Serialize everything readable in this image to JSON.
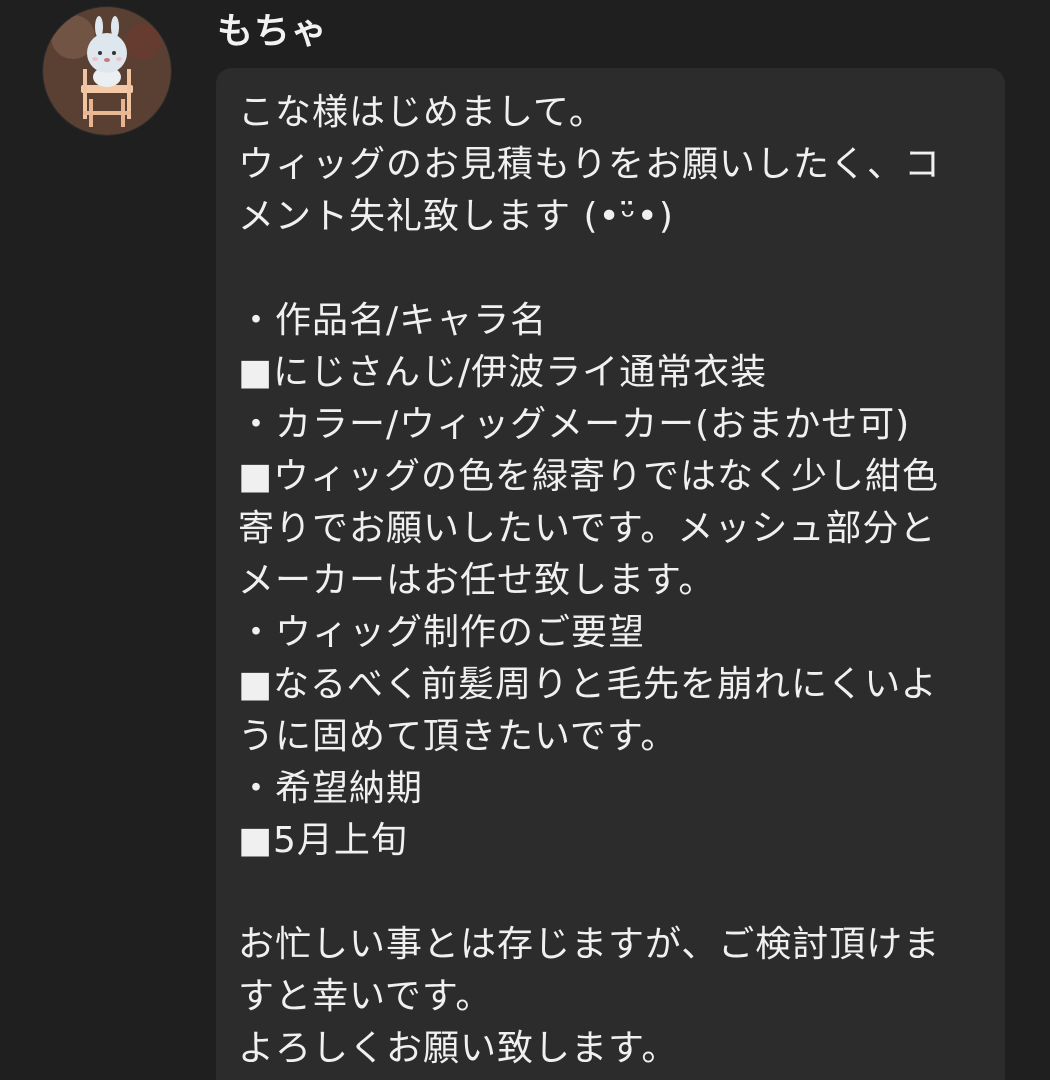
{
  "comment": {
    "author": {
      "name": "もちゃ",
      "avatar_icon": "character-figure-avatar"
    },
    "message_lines": [
      "こな様はじめまして。",
      "ウィッグのお見積もりをお願いしたく、コ",
      "メント失礼致します (•ᵕ̈•)",
      "",
      "・作品名/キャラ名",
      "■にじさんじ/伊波ライ通常衣装",
      "・カラー/ウィッグメーカー(おまかせ可)",
      "■ウィッグの色を緑寄りではなく少し紺色",
      "寄りでお願いしたいです。メッシュ部分と",
      "メーカーはお任せ致します。",
      "・ウィッグ制作のご要望",
      "■なるべく前髪周りと毛先を崩れにくいよ",
      "うに固めて頂きたいです。",
      "・希望納期",
      "■5月上旬",
      "",
      "お忙しい事とは存じますが、ご検討頂けま",
      "すと幸いです。",
      "よろしくお願い致します。"
    ]
  },
  "colors": {
    "background": "#1f1f1f",
    "bubble": "#2c2c2c",
    "text": "#f0f0f0"
  }
}
